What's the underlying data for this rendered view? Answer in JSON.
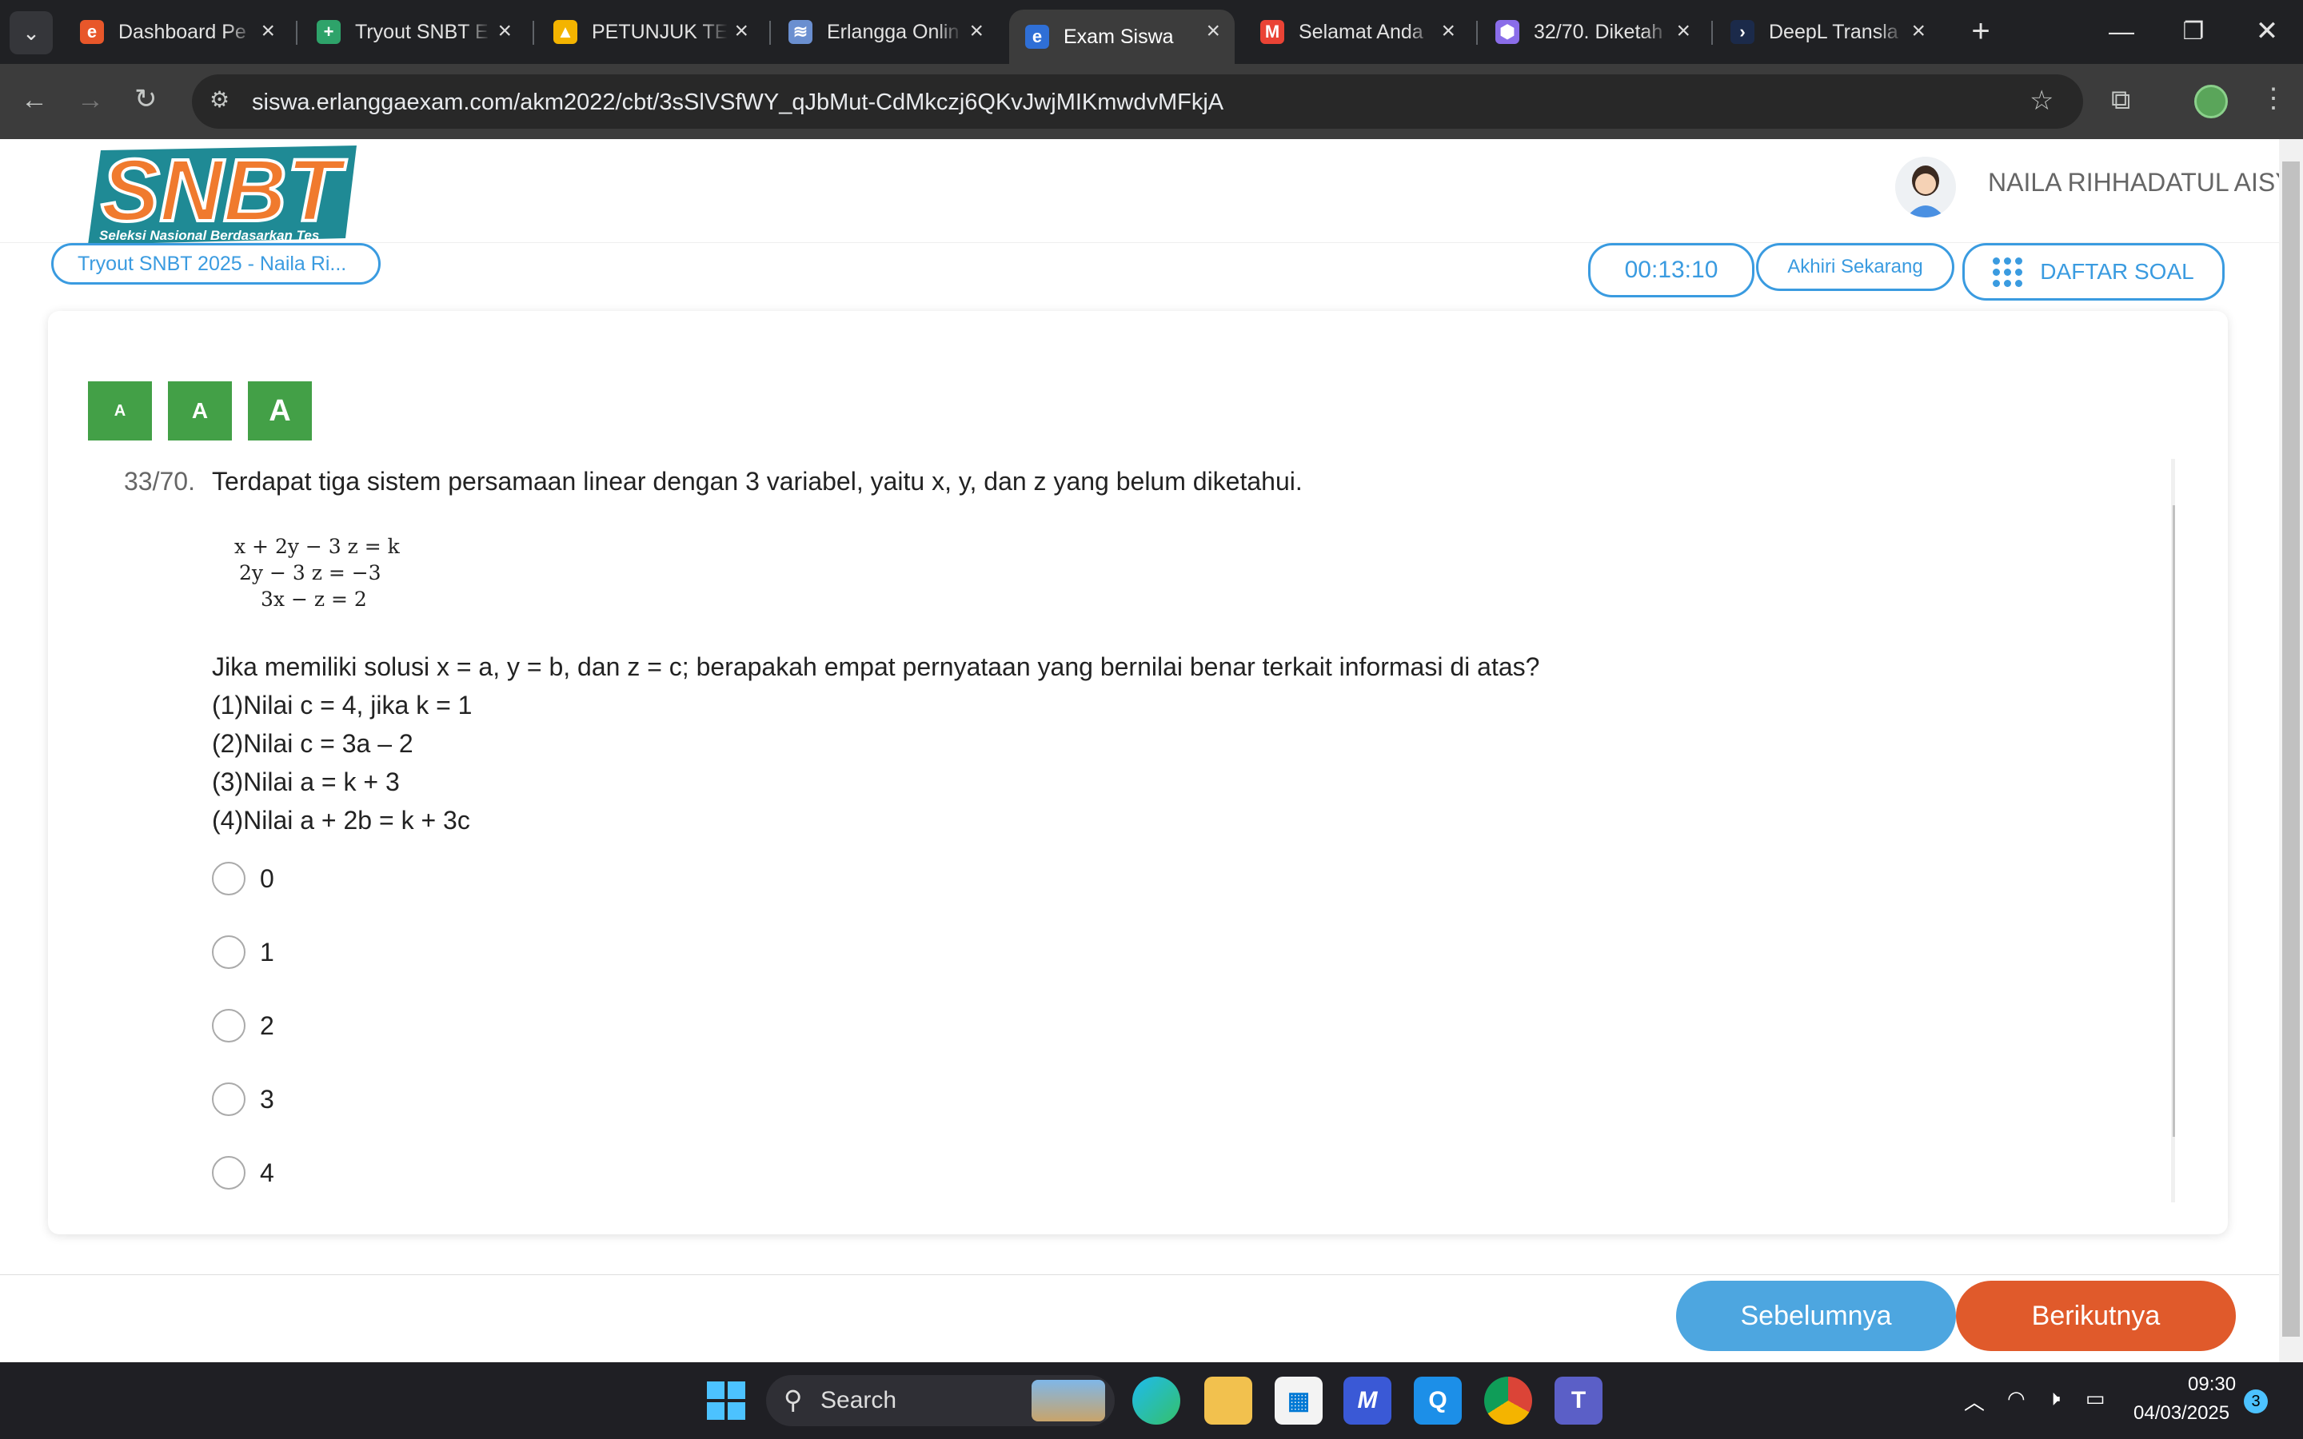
{
  "browser": {
    "tabs": [
      {
        "label": "Dashboard Pe",
        "favicon": "erlangga-e-icon",
        "color": "#e8572a",
        "glyph": "e"
      },
      {
        "label": "Tryout SNBT E",
        "favicon": "green-plus-icon",
        "color": "#2ea36a",
        "glyph": "+"
      },
      {
        "label": "PETUNJUK TEK",
        "favicon": "drive-icon",
        "color": "#f4b400",
        "glyph": "▲"
      },
      {
        "label": "Erlangga Onlin",
        "favicon": "erlangga-online-icon",
        "color": "#6a8fd0",
        "glyph": "≋"
      },
      {
        "label": "Exam Siswa",
        "favicon": "exam-siswa-icon",
        "color": "#2f6fd6",
        "glyph": "e"
      },
      {
        "label": "Selamat Anda",
        "favicon": "gmail-icon",
        "color": "#ea4335",
        "glyph": "M"
      },
      {
        "label": "32/70. Diketah",
        "favicon": "hexagon-icon",
        "color": "#8a6de9",
        "glyph": "⬢"
      },
      {
        "label": "DeepL Transla",
        "favicon": "deepl-icon",
        "color": "#1b2a4a",
        "glyph": "›"
      }
    ],
    "active_tab": 4,
    "new_tab": "+",
    "url": "siswa.erlanggaexam.com/akm2022/cbt/3sSlVSfWY_qJbMut-CdMkczj6QKvJwjMIKmwdvMFkjA"
  },
  "header": {
    "logo_text": "SNBT",
    "logo_subtitle": "Seleksi Nasional Berdasarkan Tes",
    "user_name": "NAILA RIHHADATUL AISY"
  },
  "subbar": {
    "tryout_label": "Tryout SNBT 2025 - Naila Ri...",
    "timer": "00:13:10",
    "end_button": "Akhiri Sekarang",
    "question_list_button": "DAFTAR SOAL"
  },
  "font_buttons": [
    "A",
    "A",
    "A"
  ],
  "question": {
    "number": "33/70.",
    "intro": "Terdapat tiga sistem persamaan linear dengan 3 variabel, yaitu x, y, dan z yang belum diketahui.",
    "equations": [
      "x + 2y − 3 z = k",
      "2y − 3 z = −3",
      "3x − z = 2"
    ],
    "prompt": "Jika memiliki solusi x = a, y = b, dan z = c; berapakah empat pernyataan yang bernilai benar terkait informasi di atas?",
    "statements": [
      "(1)Nilai c = 4, jika k = 1",
      "(2)Nilai c = 3a – 2",
      "(3)Nilai a = k + 3",
      "(4)Nilai a + 2b = k + 3c"
    ],
    "options": [
      "0",
      "1",
      "2",
      "3",
      "4"
    ]
  },
  "navigation": {
    "prev_label": "Sebelumnya",
    "next_label": "Berikutnya",
    "prev_color": "#4da6e0",
    "next_color": "#e05a2b"
  },
  "taskbar": {
    "search_label": "Search",
    "time": "09:30",
    "date": "04/03/2025",
    "notification_count": "3"
  }
}
